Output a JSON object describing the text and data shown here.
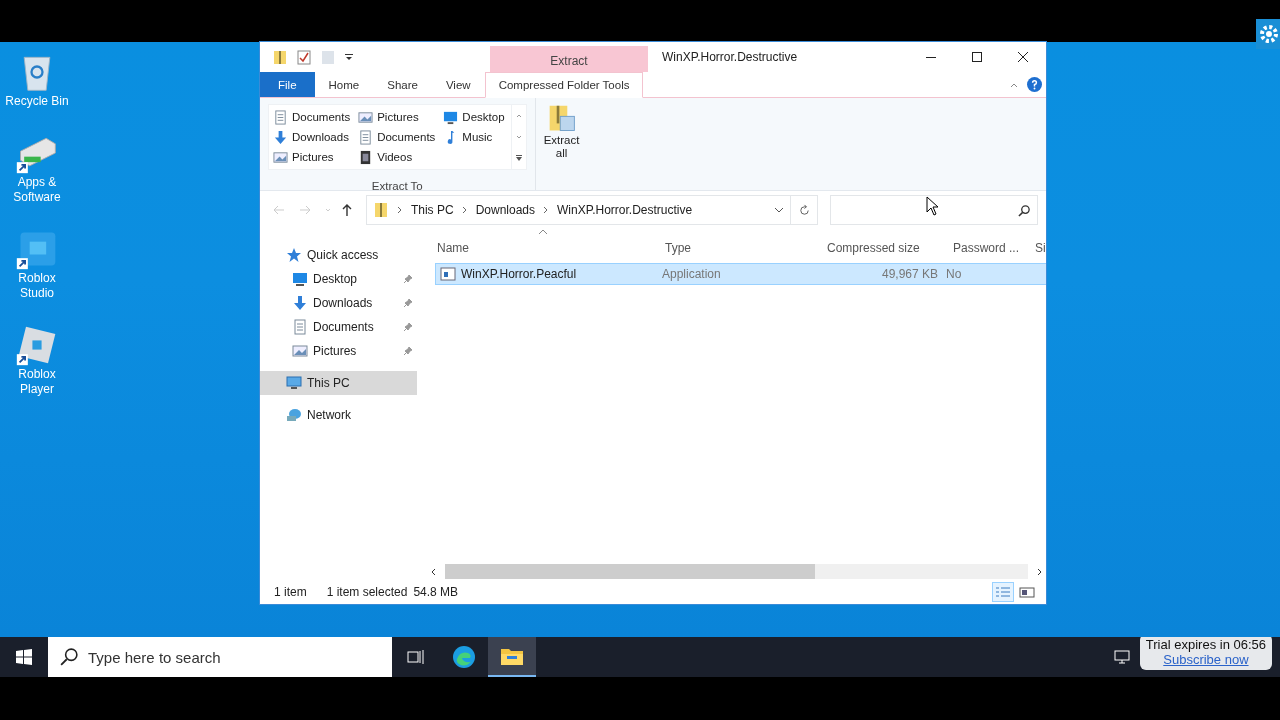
{
  "desktop_icons": [
    {
      "label": "Recycle Bin",
      "kind": "recycle",
      "shortcut": false
    },
    {
      "label": "Apps & Software",
      "kind": "drive",
      "shortcut": true
    },
    {
      "label": "Roblox Studio",
      "kind": "studio",
      "shortcut": true
    },
    {
      "label": "Roblox Player",
      "kind": "player",
      "shortcut": true
    }
  ],
  "window": {
    "title": "WinXP.Horror.Destructive",
    "context_tab": "Extract",
    "ribbon_tabs": [
      {
        "label": "File",
        "selected": false,
        "kind": "file"
      },
      {
        "label": "Home",
        "selected": false,
        "kind": "tab"
      },
      {
        "label": "Share",
        "selected": false,
        "kind": "tab"
      },
      {
        "label": "View",
        "selected": false,
        "kind": "tab"
      },
      {
        "label": "Compressed Folder Tools",
        "selected": true,
        "kind": "tab"
      }
    ],
    "extract_to": {
      "label": "Extract To",
      "items": [
        {
          "label": "Documents",
          "kind": "documents"
        },
        {
          "label": "Downloads",
          "kind": "downloads"
        },
        {
          "label": "Pictures",
          "kind": "pictures"
        },
        {
          "label": "Pictures",
          "kind": "pictures"
        },
        {
          "label": "Documents",
          "kind": "documents"
        },
        {
          "label": "Videos",
          "kind": "videos"
        },
        {
          "label": "Desktop",
          "kind": "desktop"
        },
        {
          "label": "Music",
          "kind": "music"
        }
      ]
    },
    "extract_all": "Extract all",
    "address": {
      "path": [
        "This PC",
        "Downloads",
        "WinXP.Horror.Destructive"
      ],
      "back_disabled": true,
      "forward_disabled": true
    },
    "nav": [
      {
        "label": "Quick access",
        "kind": "star",
        "selected": false,
        "children": [
          {
            "label": "Desktop",
            "kind": "desktop",
            "pinned": true,
            "selected": false
          },
          {
            "label": "Downloads",
            "kind": "downloads",
            "pinned": true,
            "selected": false
          },
          {
            "label": "Documents",
            "kind": "documents",
            "pinned": true,
            "selected": false
          },
          {
            "label": "Pictures",
            "kind": "pictures",
            "pinned": true,
            "selected": false
          }
        ]
      },
      {
        "label": "This PC",
        "kind": "pc",
        "selected": true
      },
      {
        "label": "Network",
        "kind": "network",
        "selected": false
      }
    ],
    "table": {
      "columns": [
        "Name",
        "Type",
        "Compressed size",
        "Password ...",
        "Si"
      ],
      "rows": [
        {
          "name": "WinXP.Horror.Peacful",
          "type": "Application",
          "compressed_size": "49,967 KB",
          "password": "No",
          "selected": true
        }
      ]
    },
    "status_bar": {
      "count": "1 item",
      "selection": "1 item selected",
      "size": "54.8 MB"
    }
  },
  "taskbar": {
    "search_placeholder": "Type here to search",
    "apps": [
      {
        "kind": "edge",
        "active": false
      },
      {
        "kind": "explorer",
        "active": true
      }
    ],
    "toast": {
      "text": "Trial expires in 06:56",
      "link": "Subscribe now"
    }
  }
}
